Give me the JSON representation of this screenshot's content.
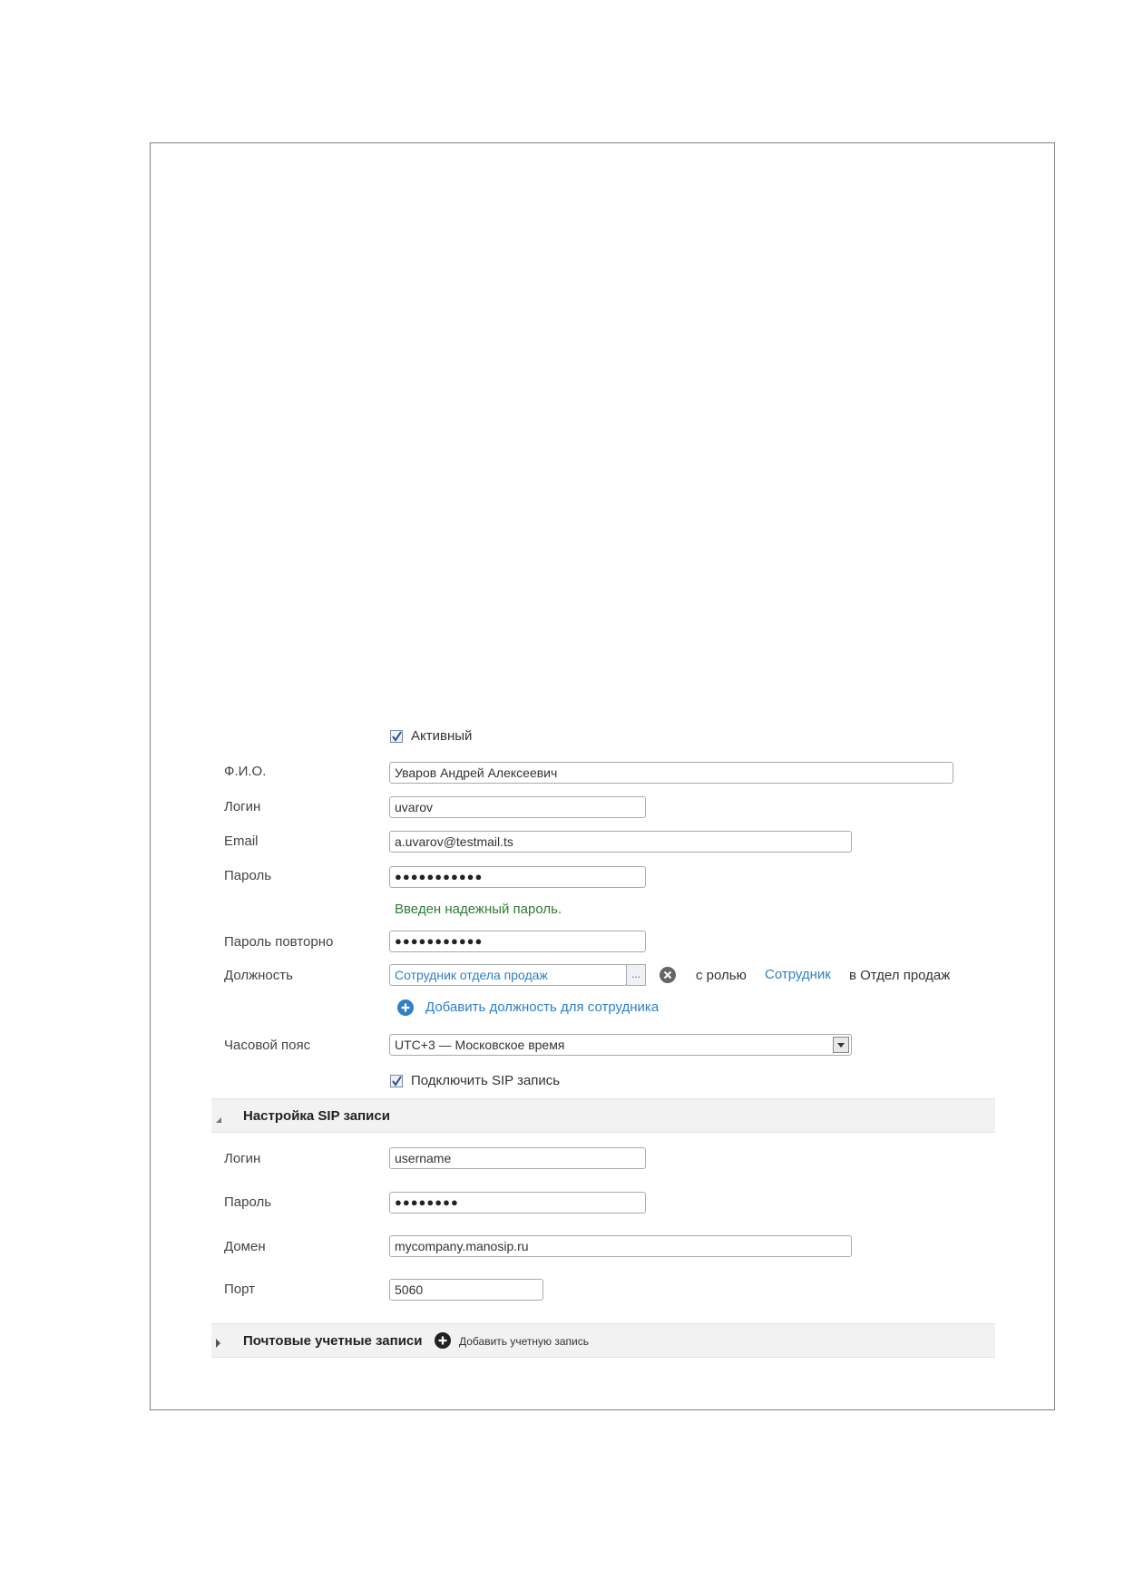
{
  "form": {
    "active_label": "Активный",
    "fio_label": "Ф.И.О.",
    "fio_value": "Уваров Андрей Алексеевич",
    "login_label": "Логин",
    "login_value": "uvarov",
    "email_label": "Email",
    "email_value": "a.uvarov@testmail.ts",
    "password_label": "Пароль",
    "password_value": "●●●●●●●●●●●",
    "password_status": "Введен надежный пароль.",
    "password_repeat_label": "Пароль повторно",
    "password_repeat_value": "●●●●●●●●●●●",
    "position_label": "Должность",
    "position_value": "Сотрудник отдела продаж",
    "position_browse": "...",
    "role_prefix": "с ролью",
    "role_value": "Сотрудник",
    "department_text": "в Отдел продаж",
    "add_position_label": "Добавить должность для сотрудника",
    "timezone_label": "Часовой пояс",
    "timezone_value": "UTC+3 — Московское время",
    "sip_checkbox_label": "Подключить SIP запись"
  },
  "sip_section": {
    "title": "Настройка SIP записи",
    "login_label": "Логин",
    "login_value": "username",
    "password_label": "Пароль",
    "password_value": "●●●●●●●●",
    "domain_label": "Домен",
    "domain_value": "mycompany.manosip.ru",
    "port_label": "Порт",
    "port_value": "5060"
  },
  "mail_section": {
    "title": "Почтовые учетные записи",
    "add_label": "Добавить учетную запись"
  },
  "colors": {
    "accent": "#2f80c4",
    "success": "#2e7d32",
    "section_bg": "#f2f2f2"
  }
}
